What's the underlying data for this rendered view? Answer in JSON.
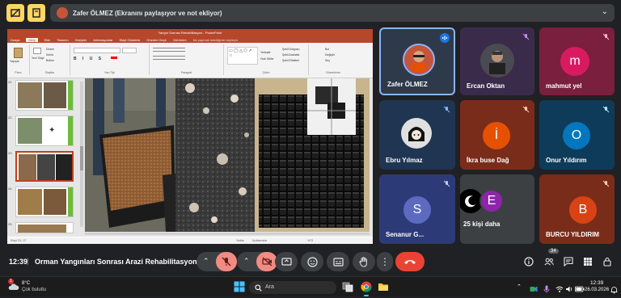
{
  "presenter_banner": {
    "text": "Zafer ÖLMEZ (Ekranını paylaşıyor ve not ekliyor)"
  },
  "shared_screen": {
    "window_title": "Yangın Sonrası Rehabilitasyon - PowerPoint",
    "menu": [
      "Dosya",
      "Giriş",
      "Ekle",
      "Tasarım",
      "Geçişler",
      "Animasyonlar",
      "Slayt Gösterisi",
      "Gözden Geçir",
      "Görünüm"
    ],
    "active_menu": "Giriş",
    "search_hint": "Ne yapmak istediğinizi söyleyin",
    "ribbon_groups": [
      "Pano",
      "Slaytlar",
      "Yazı Tipi",
      "Paragraf",
      "Çizim",
      "Düzenleme"
    ],
    "ribbon_items": {
      "paste": "Yapıştır",
      "new_slide": "Yeni Slayt",
      "layout": "Düzen",
      "reset": "Sıfırla",
      "section": "Bölüm",
      "arrange": "Yerleştir",
      "quick_styles": "Hızlı Stiller",
      "shape_fill": "Şekil Dolgusu",
      "shape_outline": "Şekil Anahattı",
      "shape_effects": "Şekil Efektleri",
      "find": "Bul",
      "replace": "Değiştir",
      "select": "Seç"
    },
    "thumb_numbers": [
      "21",
      "22",
      "23",
      "24",
      "25"
    ],
    "status": {
      "slide_counter": "Slayt 23 / 27",
      "notes": "Notlar",
      "comments": "Açıklamalar",
      "zoom": "%73"
    }
  },
  "participants": [
    {
      "name": "Zafer ÖLMEZ",
      "initial": "",
      "bg": "#2e3a4a",
      "avatar_bg": "#c5543a",
      "photo": true,
      "speaking": true
    },
    {
      "name": "Ercan Oktan",
      "initial": "",
      "bg": "#3b2b4a",
      "avatar_bg": "#555",
      "photo": true,
      "muted": true
    },
    {
      "name": "mahmut yel",
      "initial": "m",
      "bg": "#7a1f3d",
      "avatar_bg": "#d81b60",
      "muted": true
    },
    {
      "name": "Ebru Yılmaz",
      "initial": "",
      "bg": "#1f3552",
      "avatar_bg": "#ddd",
      "photo": true,
      "muted": true
    },
    {
      "name": "İkra buse Dağ",
      "initial": "İ",
      "bg": "#7a2c1a",
      "avatar_bg": "#e65100",
      "muted": true
    },
    {
      "name": "Onur Yıldırım",
      "initial": "O",
      "bg": "#0f3b5a",
      "avatar_bg": "#0277bd",
      "muted": true
    },
    {
      "name": "Senanur G...",
      "initial": "S",
      "bg": "#2d3a78",
      "avatar_bg": "#5c6bc0",
      "muted": true
    },
    {
      "name": "25 kişi daha",
      "initial": "E",
      "bg": "#3c4043",
      "avatar_bg": "#8e24aa"
    },
    {
      "name": "BURCU YILDIRIM",
      "initial": "B",
      "bg": "#7a2c1a",
      "avatar_bg": "#d84315",
      "muted": true
    }
  ],
  "bottom_bar": {
    "time": "12:39",
    "meeting_title": "Orman Yangınları Sonrası Arazi Rehabilitasyonu v...",
    "participants_count": "34"
  },
  "taskbar": {
    "weather_temp": "8°C",
    "weather_text": "Çok bulutlu",
    "weather_badge": "1",
    "search_placeholder": "Ara",
    "clock_time": "12:39",
    "clock_date": "26.03.2026"
  },
  "colors": {
    "accent_red": "#ea4335",
    "muted_red": "#f28b82",
    "ppt_red": "#b7472a",
    "yellow": "#fdd663",
    "meet_bg": "#202124"
  }
}
